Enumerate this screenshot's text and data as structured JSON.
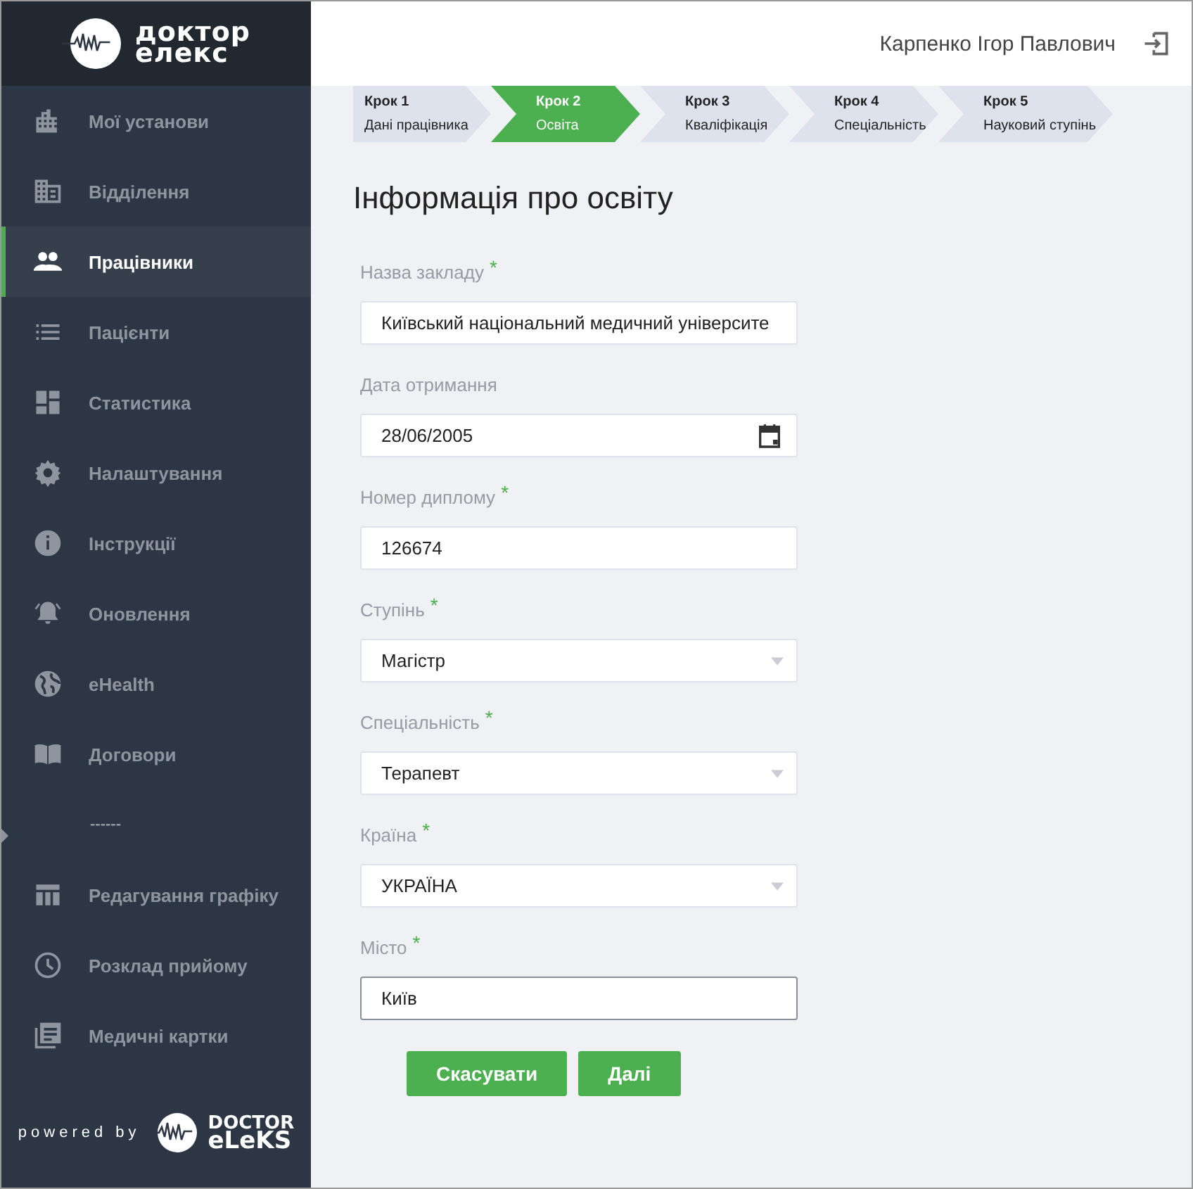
{
  "logo": {
    "line1": "доктор",
    "line2": "елекс"
  },
  "sidebar": {
    "items": [
      {
        "kind": "link",
        "label": "Мої установи",
        "selected": false
      },
      {
        "kind": "link",
        "label": "Відділення",
        "selected": false
      },
      {
        "kind": "link",
        "label": "Працівники",
        "selected": true
      },
      {
        "kind": "link",
        "label": "Пацієнти",
        "selected": false
      },
      {
        "kind": "link",
        "label": "Статистика",
        "selected": false
      },
      {
        "kind": "link",
        "label": "Налаштування",
        "selected": false
      },
      {
        "kind": "link",
        "label": "Інструкції",
        "selected": false
      },
      {
        "kind": "link",
        "label": "Оновлення",
        "selected": false
      },
      {
        "kind": "link",
        "label": "eHealth",
        "selected": false
      },
      {
        "kind": "link",
        "label": "Договори",
        "selected": false
      },
      {
        "kind": "divider",
        "label": "------",
        "selected": false
      },
      {
        "kind": "link",
        "label": "Редагування графіку",
        "selected": false
      },
      {
        "kind": "link",
        "label": "Розклад прийому",
        "selected": false
      },
      {
        "kind": "link",
        "label": "Медичні картки",
        "selected": false
      }
    ],
    "footer": {
      "powered_by": "powered by",
      "brand_line1": "DOCTOR",
      "brand_line2": "eLeKS"
    }
  },
  "header": {
    "user_name": "Карпенко Ігор Павлович"
  },
  "steps": [
    {
      "step": "Крок 1",
      "label": "Дані працівника",
      "selected": false
    },
    {
      "step": "Крок 2",
      "label": "Освіта",
      "selected": true
    },
    {
      "step": "Крок 3",
      "label": "Кваліфікація",
      "selected": false
    },
    {
      "step": "Крок 4",
      "label": "Спеціальність",
      "selected": false
    },
    {
      "step": "Крок 5",
      "label": "Науковий ступінь",
      "selected": false
    }
  ],
  "title": "Інформація про освіту",
  "fields": [
    {
      "kind": "text",
      "label": "Назва закладу",
      "required_mark": "*",
      "value": "Київський національний медичний університе",
      "focused": false
    },
    {
      "kind": "date",
      "label": "Дата отримання",
      "value": "28/06/2005",
      "focused": false
    },
    {
      "kind": "text",
      "label": "Номер диплому",
      "required_mark": "*",
      "value": "126674",
      "focused": false
    },
    {
      "kind": "select",
      "label": "Ступінь",
      "required_mark": "*",
      "value": "Магістр",
      "focused": false
    },
    {
      "kind": "select",
      "label": "Спеціальність",
      "required_mark": "*",
      "value": "Терапевт",
      "focused": false
    },
    {
      "kind": "select",
      "label": "Країна",
      "required_mark": "*",
      "value": "УКРАЇНА",
      "focused": false
    },
    {
      "kind": "text",
      "label": "Місто",
      "required_mark": "*",
      "value": "Київ",
      "focused": true
    }
  ],
  "buttons": [
    {
      "label": "Скасувати"
    },
    {
      "label": "Далі"
    }
  ]
}
